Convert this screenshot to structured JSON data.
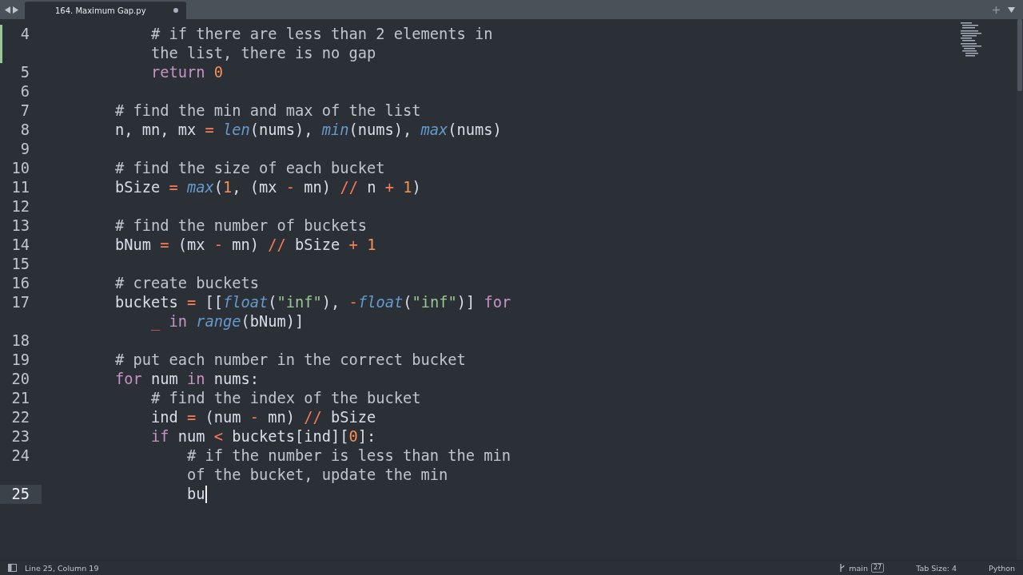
{
  "tab_bar": {
    "tabs": [
      {
        "label": "164. Maximum Gap.py",
        "selected": true,
        "modified": true
      }
    ]
  },
  "editor": {
    "lines": [
      {
        "number": "4",
        "current": false,
        "modified": true,
        "rows": [
          {
            "tokens": [
              {
                "kind": "comment",
                "text": "        # if there are less than 2 elements in"
              }
            ]
          },
          {
            "tokens": [
              {
                "kind": "comment",
                "text": "        the list, there is no gap"
              }
            ]
          }
        ]
      },
      {
        "number": "5",
        "current": false,
        "modified": false,
        "rows": [
          {
            "tokens": [
              {
                "kind": "keyword",
                "text": "        return "
              },
              {
                "kind": "number",
                "text": "0"
              }
            ]
          }
        ]
      },
      {
        "number": "6",
        "current": false,
        "modified": false
      },
      {
        "number": "7",
        "current": false,
        "modified": false,
        "rows": [
          {
            "tokens": [
              {
                "kind": "comment",
                "text": "    # find the min and max of the list"
              }
            ]
          }
        ]
      },
      {
        "number": "8",
        "current": false,
        "modified": false,
        "rows": [
          {
            "tokens": [
              {
                "kind": "plain",
                "text": "    n, mn, mx "
              },
              {
                "kind": "operator",
                "text": "= "
              },
              {
                "kind": "function",
                "text": "len"
              },
              {
                "kind": "plain",
                "text": "(nums), "
              },
              {
                "kind": "function",
                "text": "min"
              },
              {
                "kind": "plain",
                "text": "(nums), "
              },
              {
                "kind": "function",
                "text": "max"
              },
              {
                "kind": "plain",
                "text": "(nums)"
              }
            ]
          }
        ]
      },
      {
        "number": "9",
        "current": false,
        "modified": false
      },
      {
        "number": "10",
        "current": false,
        "modified": false,
        "rows": [
          {
            "tokens": [
              {
                "kind": "comment",
                "text": "    # find the size of each bucket"
              }
            ]
          }
        ]
      },
      {
        "number": "11",
        "current": false,
        "modified": false,
        "rows": [
          {
            "tokens": [
              {
                "kind": "plain",
                "text": "    bSize "
              },
              {
                "kind": "operator",
                "text": "= "
              },
              {
                "kind": "function",
                "text": "max"
              },
              {
                "kind": "plain",
                "text": "("
              },
              {
                "kind": "number",
                "text": "1"
              },
              {
                "kind": "plain",
                "text": ", (mx "
              },
              {
                "kind": "operator",
                "text": "-"
              },
              {
                "kind": "plain",
                "text": " mn) "
              },
              {
                "kind": "operator",
                "text": "//"
              },
              {
                "kind": "plain",
                "text": " n "
              },
              {
                "kind": "operator",
                "text": "+ "
              },
              {
                "kind": "number",
                "text": "1"
              },
              {
                "kind": "plain",
                "text": ")"
              }
            ]
          }
        ]
      },
      {
        "number": "12",
        "current": false,
        "modified": false
      },
      {
        "number": "13",
        "current": false,
        "modified": false,
        "rows": [
          {
            "tokens": [
              {
                "kind": "comment",
                "text": "    # find the number of buckets"
              }
            ]
          }
        ]
      },
      {
        "number": "14",
        "current": false,
        "modified": false,
        "rows": [
          {
            "tokens": [
              {
                "kind": "plain",
                "text": "    bNum "
              },
              {
                "kind": "operator",
                "text": "="
              },
              {
                "kind": "plain",
                "text": " (mx "
              },
              {
                "kind": "operator",
                "text": "-"
              },
              {
                "kind": "plain",
                "text": " mn) "
              },
              {
                "kind": "operator",
                "text": "//"
              },
              {
                "kind": "plain",
                "text": " bSize "
              },
              {
                "kind": "operator",
                "text": "+ "
              },
              {
                "kind": "number",
                "text": "1"
              }
            ]
          }
        ]
      },
      {
        "number": "15",
        "current": false,
        "modified": false
      },
      {
        "number": "16",
        "current": false,
        "modified": false,
        "rows": [
          {
            "tokens": [
              {
                "kind": "comment",
                "text": "    # create buckets"
              }
            ]
          }
        ]
      },
      {
        "number": "17",
        "current": false,
        "modified": false,
        "rows": [
          {
            "tokens": [
              {
                "kind": "plain",
                "text": "    buckets "
              },
              {
                "kind": "operator",
                "text": "="
              },
              {
                "kind": "plain",
                "text": " [["
              },
              {
                "kind": "function",
                "text": "float"
              },
              {
                "kind": "plain",
                "text": "("
              },
              {
                "kind": "string",
                "text": "\"inf\""
              },
              {
                "kind": "plain",
                "text": "), "
              },
              {
                "kind": "operator",
                "text": "-"
              },
              {
                "kind": "function",
                "text": "float"
              },
              {
                "kind": "plain",
                "text": "("
              },
              {
                "kind": "string",
                "text": "\"inf\""
              },
              {
                "kind": "plain",
                "text": ")] "
              },
              {
                "kind": "keyword",
                "text": "for"
              }
            ]
          },
          {
            "tokens": [
              {
                "kind": "variable",
                "text": "        _ "
              },
              {
                "kind": "keyword",
                "text": "in "
              },
              {
                "kind": "function",
                "text": "range"
              },
              {
                "kind": "plain",
                "text": "(bNum)]"
              }
            ]
          }
        ]
      },
      {
        "number": "18",
        "current": false,
        "modified": false
      },
      {
        "number": "19",
        "current": false,
        "modified": false,
        "rows": [
          {
            "tokens": [
              {
                "kind": "comment",
                "text": "    # put each number in the correct bucket"
              }
            ]
          }
        ]
      },
      {
        "number": "20",
        "current": false,
        "modified": false,
        "rows": [
          {
            "tokens": [
              {
                "kind": "keyword",
                "text": "    for"
              },
              {
                "kind": "plain",
                "text": " num "
              },
              {
                "kind": "keyword",
                "text": "in"
              },
              {
                "kind": "plain",
                "text": " nums:"
              }
            ]
          }
        ]
      },
      {
        "number": "21",
        "current": false,
        "modified": false,
        "rows": [
          {
            "tokens": [
              {
                "kind": "comment",
                "text": "        # find the index of the bucket"
              }
            ]
          }
        ]
      },
      {
        "number": "22",
        "current": false,
        "modified": false,
        "rows": [
          {
            "tokens": [
              {
                "kind": "plain",
                "text": "        ind "
              },
              {
                "kind": "operator",
                "text": "="
              },
              {
                "kind": "plain",
                "text": " (num "
              },
              {
                "kind": "operator",
                "text": "-"
              },
              {
                "kind": "plain",
                "text": " mn) "
              },
              {
                "kind": "operator",
                "text": "//"
              },
              {
                "kind": "plain",
                "text": " bSize"
              }
            ]
          }
        ]
      },
      {
        "number": "23",
        "current": false,
        "modified": false,
        "rows": [
          {
            "tokens": [
              {
                "kind": "keyword",
                "text": "        if"
              },
              {
                "kind": "plain",
                "text": " num "
              },
              {
                "kind": "operator",
                "text": "<"
              },
              {
                "kind": "plain",
                "text": " buckets[ind]["
              },
              {
                "kind": "number",
                "text": "0"
              },
              {
                "kind": "plain",
                "text": "]:"
              }
            ]
          }
        ]
      },
      {
        "number": "24",
        "current": false,
        "modified": false,
        "rows": [
          {
            "tokens": [
              {
                "kind": "comment",
                "text": "            # if the number is less than the min"
              }
            ]
          },
          {
            "tokens": [
              {
                "kind": "comment",
                "text": "            of the bucket, update the min"
              }
            ]
          }
        ]
      },
      {
        "number": "25",
        "current": true,
        "modified": false,
        "rows": [
          {
            "tokens": [
              {
                "kind": "plain",
                "text": "            bu"
              }
            ]
          }
        ]
      }
    ]
  },
  "status_bar": {
    "position": "Line 25, Column 19",
    "branch": "main",
    "changes": "27",
    "tab_size": "Tab Size: 4",
    "syntax": "Python"
  }
}
